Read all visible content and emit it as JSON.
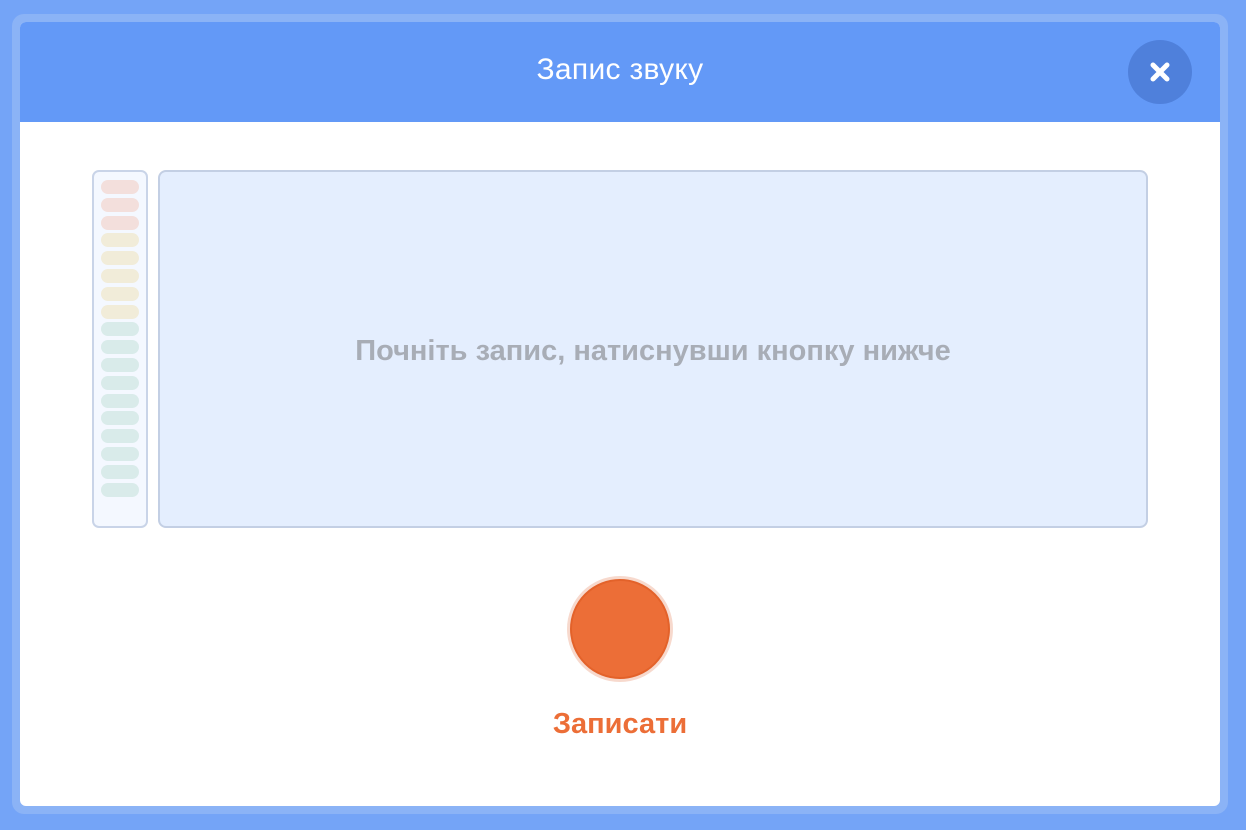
{
  "dialog": {
    "title": "Запис звуку",
    "close_icon": "close-icon"
  },
  "recorder": {
    "hint": "Почніть запис, натиснувши кнопку нижче",
    "record_label": "Записати",
    "record_icon": "record-circle-icon"
  },
  "level_meter": {
    "bar_colors": [
      "#f3dfdc",
      "#f3dfdc",
      "#f3dfdc",
      "#f1ecd9",
      "#f1ecd9",
      "#f1ecd9",
      "#f1ecd9",
      "#f1ecd9",
      "#d9ebea",
      "#d9ebea",
      "#d9ebea",
      "#d9ebea",
      "#d9ebea",
      "#d9ebea",
      "#d9ebea",
      "#d9ebea",
      "#d9ebea",
      "#d9ebea"
    ]
  },
  "colors": {
    "header": "#6399f7",
    "accent": "#ec6e37",
    "hint_text": "#a8adb6"
  }
}
